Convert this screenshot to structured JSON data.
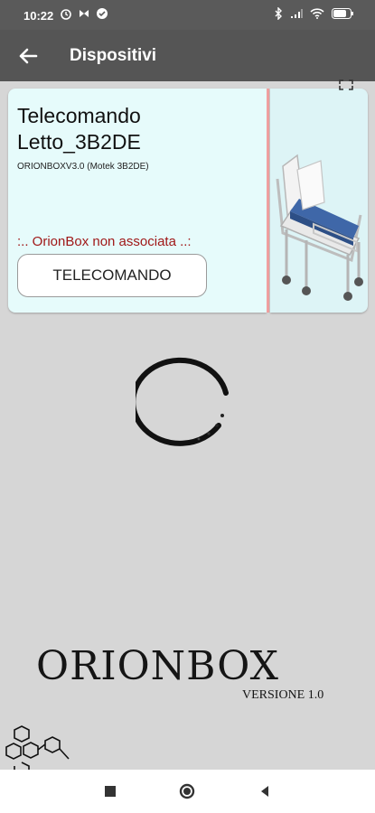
{
  "status_bar": {
    "time": "10:22",
    "battery": "66"
  },
  "app_bar": {
    "title": "Dispositivi"
  },
  "device": {
    "name": "Telecomando Letto_3B2DE",
    "model": "ORIONBOXV3.0 (Motek 3B2DE)",
    "status": ":.. OrionBox non associata ..:",
    "remote_button_label": "TELECOMANDO"
  },
  "branding": {
    "name": "ORIONBOX",
    "version": "VERSIONE 1.0"
  },
  "colors": {
    "app_bar": "#555555",
    "status_bar": "#5a5a5a",
    "background": "#d6d6d6",
    "card": "#e6fbfb",
    "status_text": "#a01818"
  },
  "icons": [
    "back-arrow-icon",
    "alarm-icon",
    "bluetooth-icon",
    "signal-icon",
    "wifi-icon",
    "battery-icon",
    "hospital-bed-icon",
    "expand-icon",
    "loading-spinner",
    "hexagon-molecule-icon",
    "recents-button",
    "home-button",
    "back-button"
  ]
}
